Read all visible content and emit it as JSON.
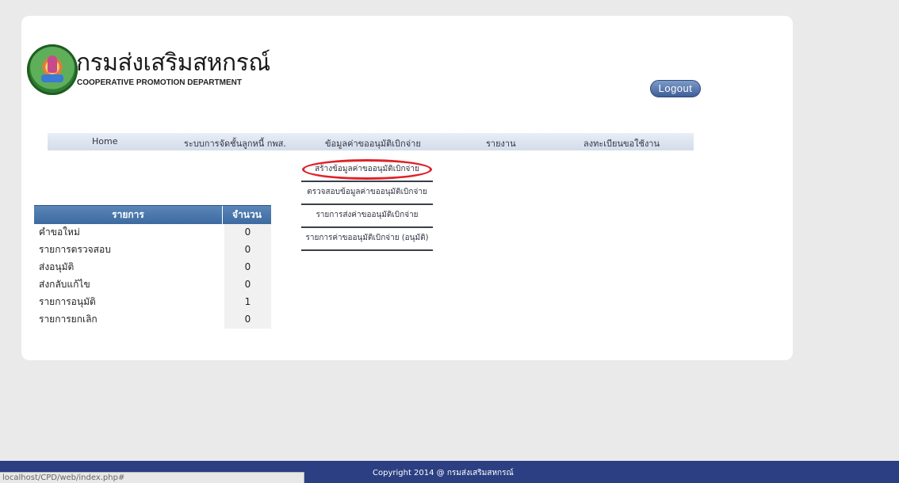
{
  "header": {
    "title_th": "กรมส่งเสริมสหกรณ์",
    "title_en": "COOPERATIVE PROMOTION DEPARTMENT",
    "logout_label": "Logout"
  },
  "nav": {
    "items": [
      {
        "label": "Home"
      },
      {
        "label": "ระบบการจัดชั้นลูกหนี้ กพส."
      },
      {
        "label": "ข้อมูลค่าขออนุมัติเบิกจ่าย"
      },
      {
        "label": "รายงาน"
      },
      {
        "label": "ลงทะเบียนขอใช้งาน"
      }
    ]
  },
  "dropdown": {
    "items": [
      {
        "label": "สร้างข้อมูลค่าขออนุมัติเบิกจ่าย",
        "highlighted": true
      },
      {
        "label": "ตรวจสอบข้อมูลค่าขออนุมัติเบิกจ่าย"
      },
      {
        "label": "รายการส่งค่าขออนุมัติเบิกจ่าย"
      },
      {
        "label": "รายการค่าขออนุมัติเบิกจ่าย (อนุมัติ)"
      }
    ],
    "highlight_color": "#e0222a"
  },
  "summary": {
    "headers": {
      "item": "รายการ",
      "count": "จำนวน"
    },
    "rows": [
      {
        "item": "คำขอใหม่",
        "count": "0"
      },
      {
        "item": "รายการตรวจสอบ",
        "count": "0"
      },
      {
        "item": "ส่งอนุมัติ",
        "count": "0"
      },
      {
        "item": "ส่งกลับแก้ไข",
        "count": "0"
      },
      {
        "item": "รายการอนุมัติ",
        "count": "1"
      },
      {
        "item": "รายการยกเลิก",
        "count": "0"
      }
    ]
  },
  "footer": {
    "copyright": "Copyright 2014 @ กรมส่งเสริมสหกรณ์"
  },
  "statusbar": {
    "url": "localhost/CPD/web/index.php#"
  },
  "colors": {
    "footer_bg": "#2b3f82",
    "table_header_bg": "#4a77ac",
    "page_bg": "#eaeaea"
  }
}
